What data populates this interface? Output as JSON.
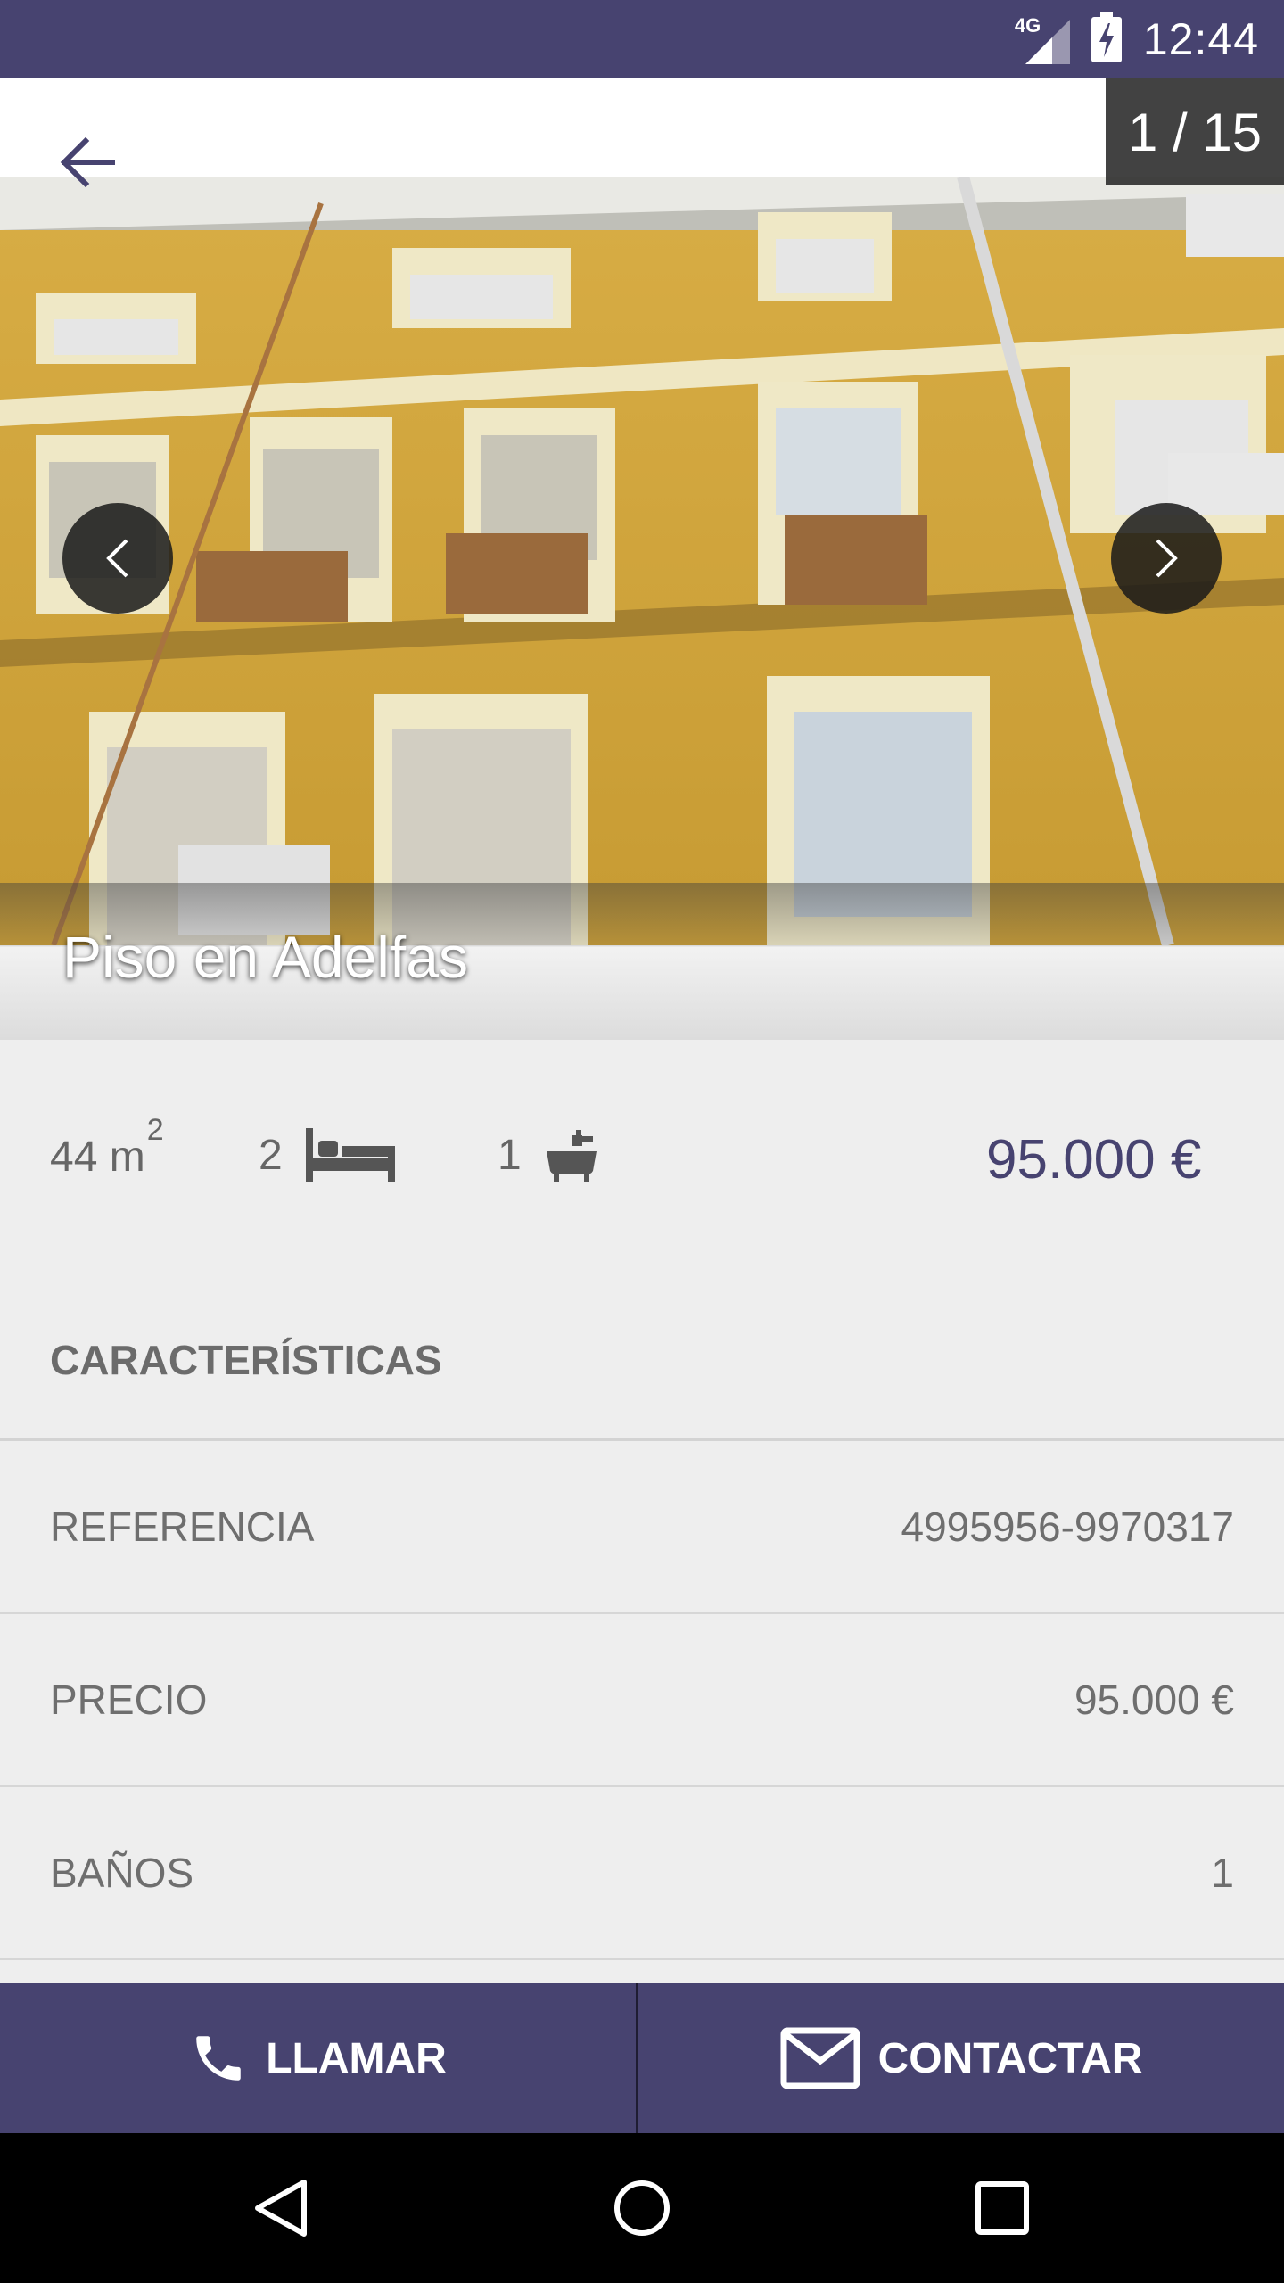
{
  "status_bar": {
    "time": "12:44",
    "network": "4G",
    "background": "#474370"
  },
  "gallery": {
    "counter": "1 / 15",
    "title": "Piso en Adelfas"
  },
  "summary": {
    "area_value": "44 m",
    "area_unit_sup": "2",
    "bedrooms": "2",
    "bathrooms": "1",
    "price": "95.000 €",
    "icons": [
      "bed-icon",
      "bathtub-icon"
    ]
  },
  "features": {
    "section_title": "CARACTERÍSTICAS",
    "rows": [
      {
        "label": "REFERENCIA",
        "value": "4995956-9970317"
      },
      {
        "label": "PRECIO",
        "value": "95.000 €"
      },
      {
        "label": "BAÑOS",
        "value": "1"
      }
    ]
  },
  "actions": {
    "call_label": "LLAMAR",
    "contact_label": "CONTACTAR",
    "accent": "#474370"
  },
  "nav_icons": [
    "back-triangle-icon",
    "home-circle-icon",
    "recents-square-icon"
  ]
}
